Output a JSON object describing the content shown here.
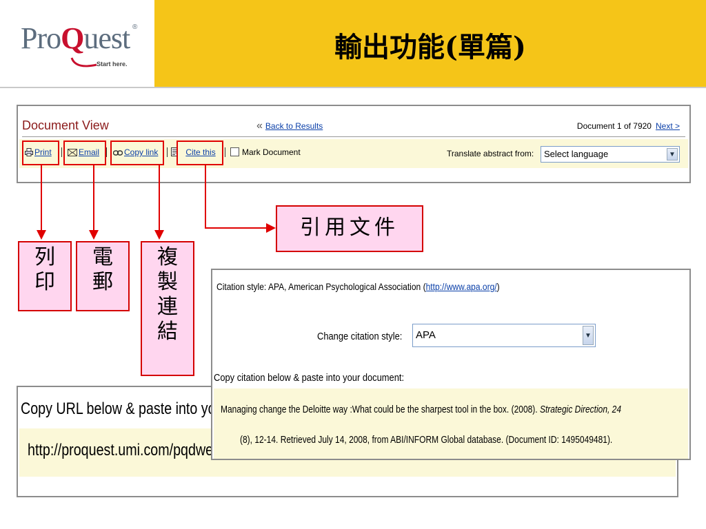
{
  "header": {
    "logo": {
      "pro": "Pro",
      "q": "Q",
      "uest": "uest",
      "reg": "®",
      "tagline": "Start here."
    },
    "title": "輸出功能(單篇)"
  },
  "document_view": {
    "title": "Document View",
    "back_chevron": "«",
    "back_link": "Back to Results",
    "doc_count": "Document 1 of 7920",
    "next_link": "Next >",
    "toolbar": {
      "print": "Print",
      "email": "Email",
      "copy_link": "Copy link",
      "cite_this": "Cite this",
      "mark_document": "Mark Document",
      "translate_label": "Translate abstract from:",
      "language_select": "Select language"
    }
  },
  "callouts": {
    "cite": "引用文件",
    "print": "列印",
    "email": "電郵",
    "copy_link": "複製連結"
  },
  "url_panel": {
    "heading": "Copy URL below & paste into yo",
    "url": "http://proquest.umi.com/pqdwe"
  },
  "citation_panel": {
    "style_prefix": "Citation style: APA, American Psychological Association (",
    "style_link": "http://www.apa.org/",
    "style_suffix": ")",
    "change_label": "Change citation style:",
    "change_select": "APA",
    "copy_label": "Copy citation below & paste into your document:",
    "citation_line1": "Managing change the Deloitte way :What could be the sharpest tool in the box. (2008).",
    "citation_journal": "Strategic Direction, 24",
    "citation_line2": "(8), 12-14.  Retrieved July 14, 2008, from ABI/INFORM Global database. (Document ID: 1495049481)."
  },
  "colors": {
    "header_yellow": "#f5c518",
    "callout_red": "#e00000",
    "callout_pink": "#ffd6ef",
    "panel_cream": "#fbf8d8",
    "link_blue": "#0a3fa8",
    "title_maroon": "#8b1a1a"
  }
}
